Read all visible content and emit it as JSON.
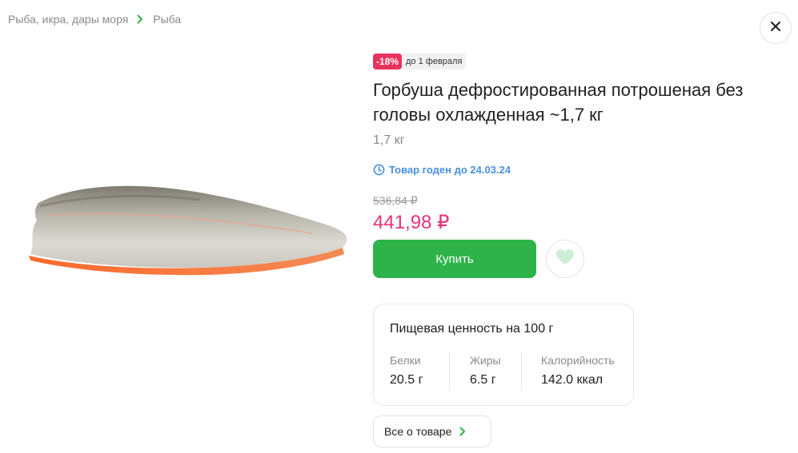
{
  "breadcrumb": {
    "items": [
      "Рыба, икра, дары моря",
      "Рыба"
    ]
  },
  "product": {
    "discount_badge": "-18%",
    "discount_until": "до 1 февраля",
    "title": "Горбуша дефростированная потрошеная без головы охлажденная ~1,7 кг",
    "weight": "1,7 кг",
    "expiry": "Товар годен до 24.03.24",
    "old_price": "536,84 ₽",
    "price": "441,98 ₽",
    "buy_label": "Купить"
  },
  "nutrition": {
    "title_bold": "Пищевая ценность",
    "title_rest": "на 100 г",
    "items": [
      {
        "label": "Белки",
        "value": "20.5 г"
      },
      {
        "label": "Жиры",
        "value": "6.5 г"
      },
      {
        "label": "Калорийность",
        "value": "142.0 ккал"
      }
    ]
  },
  "about_button": "Все о товаре",
  "colors": {
    "accent_green": "#2db34a",
    "price_pink": "#e8327a",
    "discount_red": "#e8325e",
    "expiry_blue": "#4a90e2"
  },
  "icons": [
    "chevron-right-icon",
    "close-icon",
    "clock-icon",
    "heart-icon"
  ]
}
